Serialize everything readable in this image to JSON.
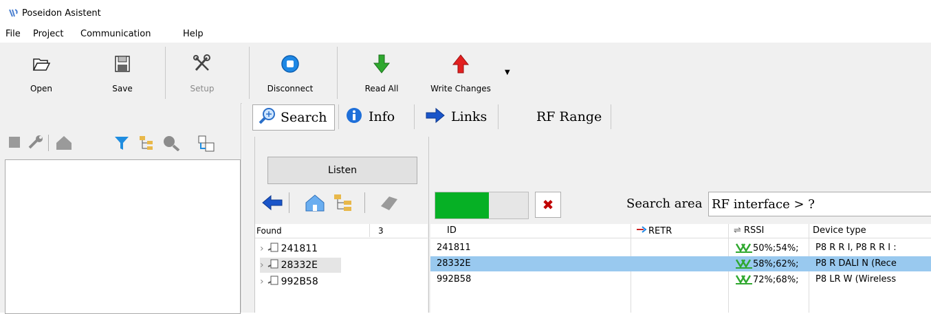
{
  "app": {
    "title": "Poseidon Asistent"
  },
  "menu": {
    "items": [
      "File",
      "Project",
      "Communication",
      "Help"
    ]
  },
  "toolbar": {
    "open": "Open",
    "save": "Save",
    "setup": "Setup",
    "disconnect": "Disconnect",
    "read_all": "Read All",
    "write_changes": "Write Changes"
  },
  "tabs": [
    "Search",
    "Info",
    "Links",
    "RF Range"
  ],
  "search": {
    "listen": "Listen",
    "found_label": "Found",
    "found_count": "3",
    "found_items": [
      "241811",
      "28332E",
      "992B58"
    ],
    "progress": 0.57,
    "search_area_label": "Search area",
    "search_area_value": "RF interface > ?"
  },
  "table": {
    "columns": [
      "ID",
      "RETR",
      "RSSI",
      "Device type"
    ],
    "rows": [
      {
        "id": "241811",
        "retr": "",
        "rssi": "50%;54%;",
        "device": "P8 R R I, P8 R R I :"
      },
      {
        "id": "28332E",
        "retr": "",
        "rssi": "58%;62%;",
        "device": "P8 R DALI N  (Rece"
      },
      {
        "id": "992B58",
        "retr": "",
        "rssi": "72%;68%;",
        "device": "P8 LR W  (Wireless"
      }
    ],
    "selected_row": 1
  },
  "colors": {
    "selection": "#99c9ef",
    "progress": "#06b025",
    "accent": "#1e88e5"
  }
}
